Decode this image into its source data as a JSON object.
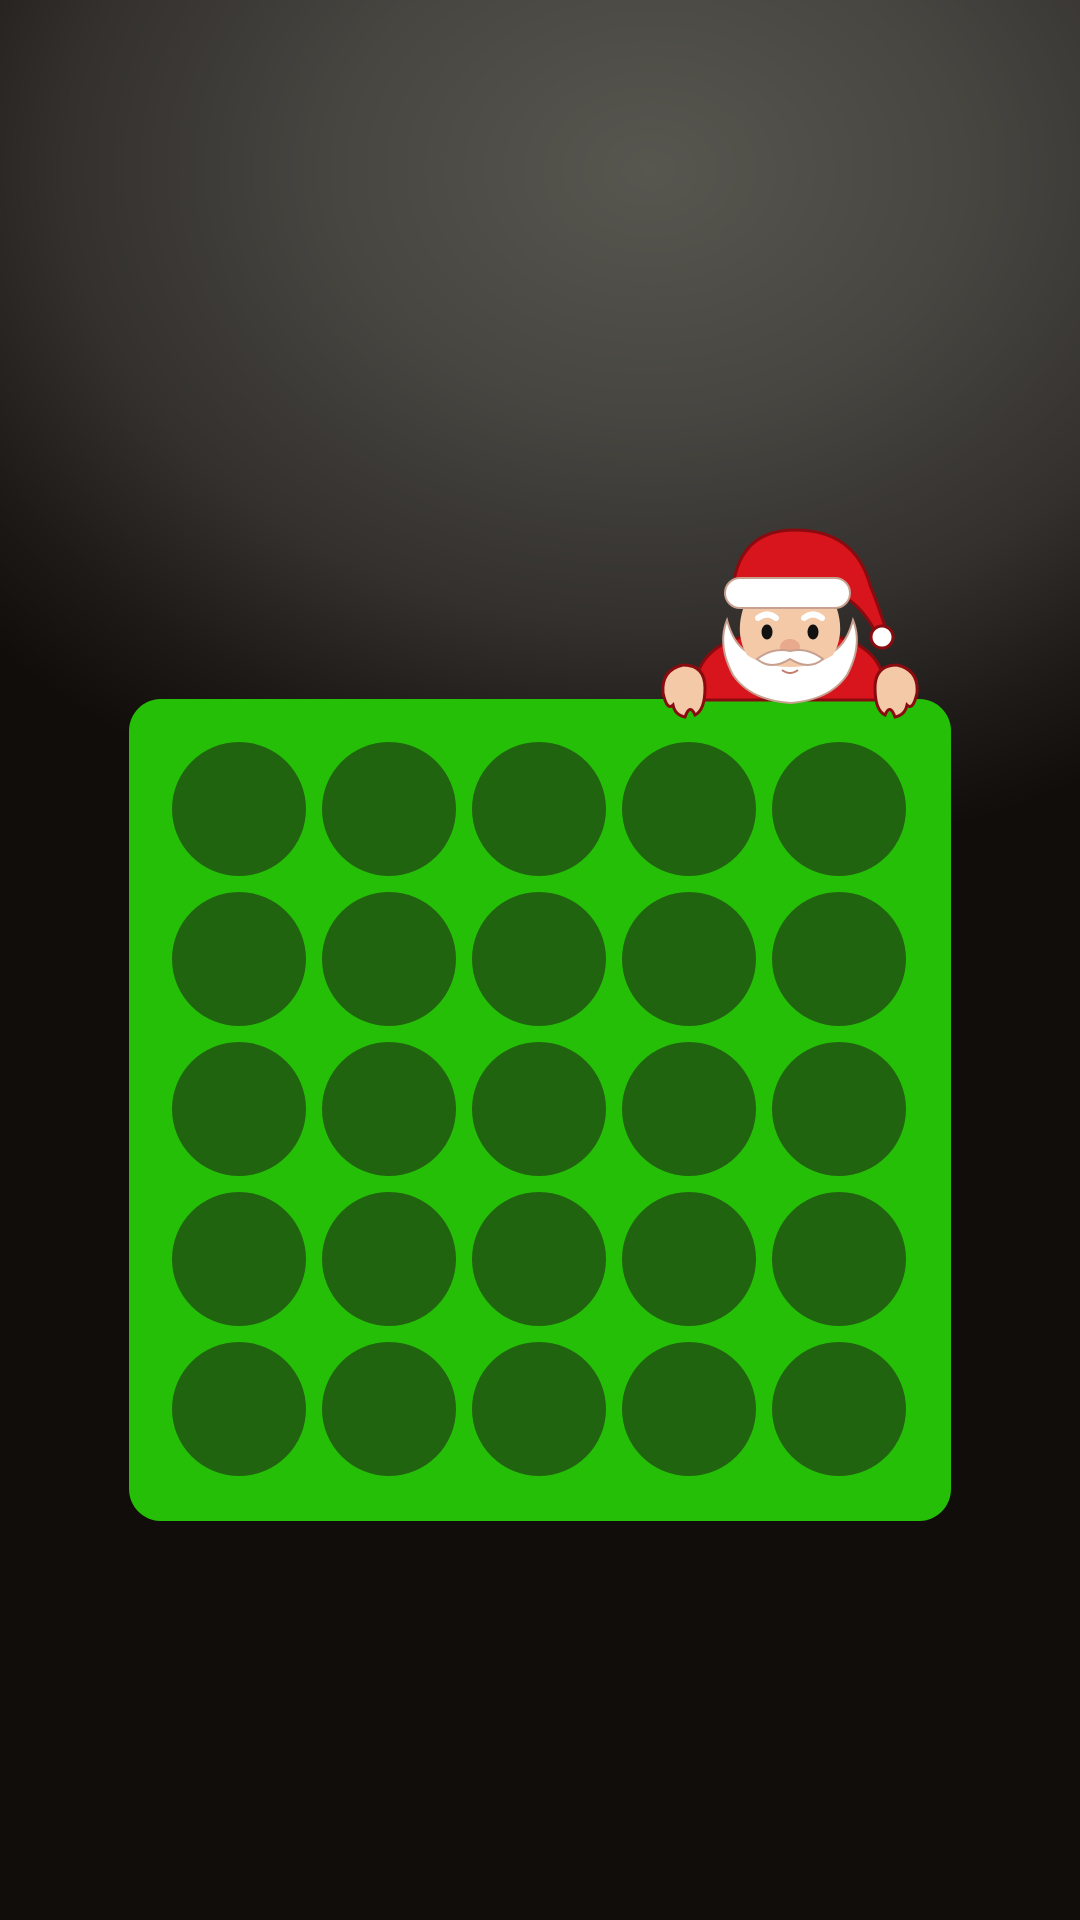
{
  "game": {
    "type": "connect-grid",
    "rows": 5,
    "columns": 5,
    "board_color": "#26bf08",
    "empty_slot_color": "rgba(30,26,22,0.55)",
    "cells": [
      [
        "empty",
        "empty",
        "empty",
        "empty",
        "empty"
      ],
      [
        "empty",
        "empty",
        "empty",
        "empty",
        "empty"
      ],
      [
        "empty",
        "empty",
        "empty",
        "empty",
        "empty"
      ],
      [
        "empty",
        "empty",
        "empty",
        "empty",
        "empty"
      ],
      [
        "empty",
        "empty",
        "empty",
        "empty",
        "empty"
      ]
    ]
  },
  "decoration": {
    "mascot": "santa-claus-icon"
  },
  "colors": {
    "background_top": "#57564f",
    "background_bottom": "#100d0a",
    "board": "#26bf08",
    "santa_hat": "#d8141c",
    "santa_skin": "#f3c9a8",
    "santa_beard": "#ffffff"
  }
}
